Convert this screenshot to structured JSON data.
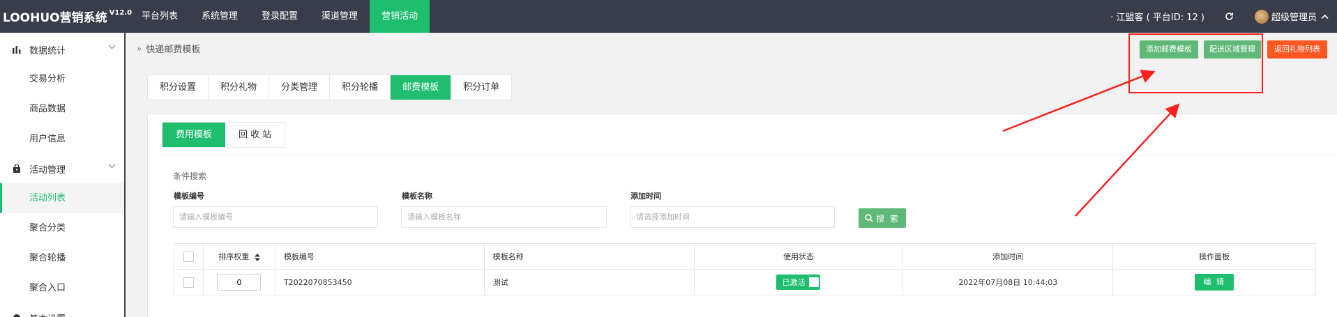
{
  "brand": {
    "name": "LOOHUO营销系统",
    "version": "V12.0"
  },
  "topnav": [
    {
      "label": "平台列表",
      "active": false
    },
    {
      "label": "系统管理",
      "active": false
    },
    {
      "label": "登录配置",
      "active": false
    },
    {
      "label": "渠道管理",
      "active": false
    },
    {
      "label": "营销活动",
      "active": true
    }
  ],
  "platform_info": "· 江盟客 ( 平台ID: 12 )",
  "admin_name": "超级管理员",
  "sidebar": {
    "groups": [
      {
        "label": "数据统计",
        "icon": "bar-chart-icon",
        "items": [
          "交易分析",
          "商品数据",
          "用户信息"
        ]
      },
      {
        "label": "活动管理",
        "icon": "bag-icon",
        "items": [
          "活动列表",
          "聚合分类",
          "聚合轮播",
          "聚合入口"
        ]
      }
    ],
    "active_item": "活动列表",
    "partial_next_group": "基本设置"
  },
  "breadcrumb": "快递邮费模板",
  "actions": {
    "add_template": "添加邮费模板",
    "area_manage": "配送区域管理",
    "back_to_list": "返回礼物列表"
  },
  "tabs": [
    {
      "label": "积分设置",
      "active": false
    },
    {
      "label": "积分礼物",
      "active": false
    },
    {
      "label": "分类管理",
      "active": false
    },
    {
      "label": "积分轮播",
      "active": false
    },
    {
      "label": "邮费模板",
      "active": true
    },
    {
      "label": "积分订单",
      "active": false
    }
  ],
  "subtabs": [
    {
      "label": "费用模板",
      "active": true
    },
    {
      "label": "回 收 站",
      "active": false
    }
  ],
  "search": {
    "title": "条件搜索",
    "fields": [
      {
        "label": "模板编号",
        "placeholder": "请输入模板编号"
      },
      {
        "label": "模板名称",
        "placeholder": "请输入模板名称"
      },
      {
        "label": "添加时间",
        "placeholder": "请选择添加时间"
      }
    ],
    "button": "搜 索"
  },
  "table": {
    "headers": [
      "排序权重",
      "模板编号",
      "模板名称",
      "使用状态",
      "添加时间",
      "操作面板"
    ],
    "rows": [
      {
        "sort": "0",
        "code": "T2022070853450",
        "name": "测试",
        "status": "已激活",
        "time": "2022年07月08日 10:44:03",
        "action": "编 辑"
      }
    ]
  },
  "colors": {
    "primary": "#1ebe6e",
    "topbar": "#393d49",
    "light_green": "#5fb878",
    "orange": "#ff5722",
    "annotation": "#ff2020"
  }
}
